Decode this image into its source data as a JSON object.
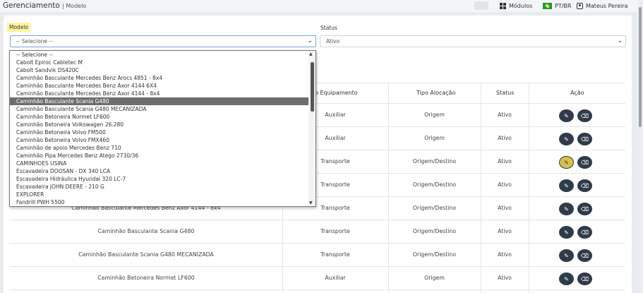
{
  "header": {
    "title": "Gerenciamento",
    "subtitle": "| Modelo",
    "modules_label": "Módulos",
    "locale_label": "PT/BR",
    "user_name": "Mateus Pereira"
  },
  "filters": {
    "modelo_label": "Modelo",
    "modelo_value": "-- Selecione --",
    "status_label": "Status",
    "status_value": "Ativo"
  },
  "dropdown": {
    "options": [
      "-- Selecione --",
      "Cabolt Epiroc Cabletec M",
      "Cabolt Sandvik DS420C",
      "Caminhão Basculante Mercedes Benz Arocs 4851 - 8x4",
      "Caminhão Basculante Mercedes Benz Axor 4144 6X4",
      "Caminhão Basculante Mercedes Benz Axor 4144 - 8x4",
      "Caminhão Basculante Scania G480",
      "Caminhão Basculante Scania G480 MECANIZADA",
      "Caminhão Betoneira Normet LF600",
      "Caminhão Betoneira Volkswagen 26.280",
      "Caminhão Betoneira Volvo FM500",
      "Caminhão Betoneira Volvo FMX460",
      "Caminhão de apoio Mercedes Benz 710",
      "Caminhão Pipa Mercedes Benz Atego 2730/36",
      "CAMINHOES USINA",
      "Escavadeira DOOSAN - DX 340 LCA",
      "Escavadeira Hidráulica Hyundai 320 LC-7",
      "Escavadeira JOHN DEERE - 210 G",
      "EXPLORER",
      "Fandrill PWH 5500"
    ],
    "selected_index": 6
  },
  "table": {
    "headers": [
      "Tipo Equipamento",
      "Tipo Alocação",
      "Status",
      "Ação"
    ],
    "header_partial": "o Equipamento",
    "rows": [
      {
        "model": "",
        "equip": "Auxiliar",
        "aloc": "Origem",
        "status": "Ativo"
      },
      {
        "model": "",
        "equip": "Auxiliar",
        "aloc": "Origem",
        "status": "Ativo"
      },
      {
        "model": "",
        "equip": "Transporte",
        "aloc": "Origem/Destino",
        "status": "Ativo"
      },
      {
        "model": "",
        "equip": "Transporte",
        "aloc": "Origem/Destino",
        "status": "Ativo"
      },
      {
        "model": "Caminhão Basculante Mercedes Benz Axor 4144 - 8x4",
        "equip": "Transporte",
        "aloc": "Origem/Destino",
        "status": "Ativo"
      },
      {
        "model": "Caminhão Basculante Scania G480",
        "equip": "Transporte",
        "aloc": "Origem/Destino",
        "status": "Ativo"
      },
      {
        "model": "Caminhão Basculante Scania G480 MECANIZADA",
        "equip": "Transporte",
        "aloc": "Origem/Destino",
        "status": "Ativo"
      },
      {
        "model": "Caminhão Betoneira Normet LF600",
        "equip": "Auxiliar",
        "aloc": "Origem",
        "status": "Ativo"
      }
    ]
  },
  "icons": {
    "edit": "pencil-icon",
    "delete": "eraser-icon",
    "chevron": "chevron-down-icon"
  },
  "colors": {
    "highlight": "#fff59d",
    "action_button": "#2f3b48",
    "selected_option": "#6d6d6d"
  }
}
